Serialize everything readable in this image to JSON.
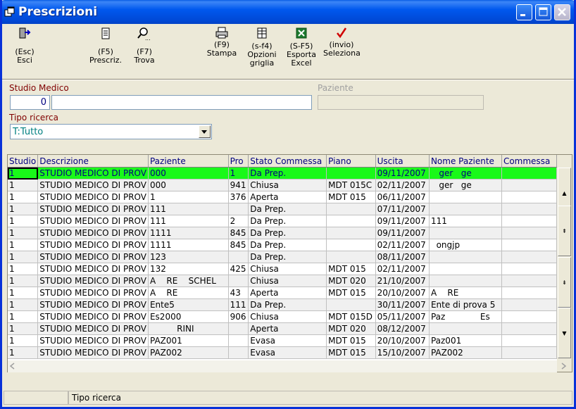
{
  "window": {
    "title": "Prescrizioni"
  },
  "toolbar": [
    {
      "key": "(Esc)",
      "label": "Esci",
      "icon": "exit-icon"
    },
    {
      "key": "(F5)",
      "label": "Prescriz.",
      "icon": "document-icon"
    },
    {
      "key": "(F7)",
      "label": "Trova",
      "icon": "magnifier-icon"
    },
    {
      "key": "(F9)",
      "label": "Stampa",
      "icon": "printer-icon"
    },
    {
      "key": "(s-f4)",
      "label": "Opzioni griglia",
      "label2": "griglia",
      "label1": "Opzioni",
      "icon": "grid-options-icon"
    },
    {
      "key": "(S-F5)",
      "label1": "Esporta",
      "label2": "Excel",
      "icon": "excel-icon"
    },
    {
      "key": "(invio)",
      "label": "Seleziona",
      "icon": "checkmark-icon"
    }
  ],
  "filters": {
    "studio_label": "Studio Medico",
    "studio_code": "0",
    "studio_name": "",
    "paziente_label": "Paziente",
    "paziente_value": "",
    "tipo_label": "Tipo ricerca",
    "tipo_value": "T:Tutto"
  },
  "grid": {
    "columns": [
      "Studio",
      "Descrizione",
      "Paziente",
      "Pro",
      "Stato Commessa",
      "Piano",
      "Uscita",
      "Nome Paziente",
      "Commessa"
    ],
    "rows": [
      [
        "1",
        "STUDIO MEDICO DI PROV",
        "000",
        "1",
        "Da Prep.",
        "",
        "09/11/2007",
        "   ger   ge",
        ""
      ],
      [
        "1",
        "STUDIO MEDICO DI PROV",
        "000",
        "941",
        "Chiusa",
        "MDT 015C",
        "02/11/2007",
        "   ger   ge",
        ""
      ],
      [
        "1",
        "STUDIO MEDICO DI PROV",
        "1",
        "376",
        "Aperta",
        "MDT 015",
        "06/11/2007",
        "",
        ""
      ],
      [
        "1",
        "STUDIO MEDICO DI PROV",
        "111",
        "",
        "Da Prep.",
        "",
        "07/11/2007",
        "",
        ""
      ],
      [
        "1",
        "STUDIO MEDICO DI PROV",
        "111",
        "2",
        "Da Prep.",
        "",
        "09/11/2007",
        "111",
        ""
      ],
      [
        "1",
        "STUDIO MEDICO DI PROV",
        "1111",
        "845",
        "Da Prep.",
        "",
        "09/11/2007",
        "",
        ""
      ],
      [
        "1",
        "STUDIO MEDICO DI PROV",
        "1111",
        "845",
        "Da Prep.",
        "",
        "02/11/2007",
        "  ongjp",
        ""
      ],
      [
        "1",
        "STUDIO MEDICO DI PROV",
        "123",
        "",
        "Da Prep.",
        "",
        "08/11/2007",
        "",
        ""
      ],
      [
        "1",
        "STUDIO MEDICO DI PROV",
        "132",
        "425",
        "Chiusa",
        "MDT 015",
        "02/11/2007",
        "",
        ""
      ],
      [
        "1",
        "STUDIO MEDICO DI PROV",
        "A    RE    SCHEL",
        "",
        "Chiusa",
        "MDT 020",
        "21/10/2007",
        "",
        ""
      ],
      [
        "1",
        "STUDIO MEDICO DI PROV",
        "A    RE",
        "43",
        "Aperta",
        "MDT 015",
        "20/10/2007",
        "A    RE",
        ""
      ],
      [
        "1",
        "STUDIO MEDICO DI PROV",
        "Ente5",
        "111",
        "Da Prep.",
        "",
        "30/11/2007",
        "Ente di prova 5",
        ""
      ],
      [
        "1",
        "STUDIO MEDICO DI PROV",
        "Es2000",
        "906",
        "Chiusa",
        "MDT 015D",
        "05/11/2007",
        "Paz             Es",
        ""
      ],
      [
        "1",
        "STUDIO MEDICO DI PROV",
        "          RINI",
        "",
        "Aperta",
        "MDT 020",
        "08/12/2007",
        "",
        ""
      ],
      [
        "1",
        "STUDIO MEDICO DI PROV",
        "PAZ001",
        "",
        "Evasa",
        "MDT 015",
        "20/10/2007",
        "Paz001",
        ""
      ],
      [
        "1",
        "STUDIO MEDICO DI PROV",
        "PAZ002",
        "",
        "Evasa",
        "MDT 015",
        "15/10/2007",
        "PAZ002",
        ""
      ]
    ]
  },
  "status": {
    "panel1": "",
    "panel2": "Tipo ricerca"
  },
  "colors": {
    "selected_row": "#19f919",
    "title_bar": "#0058ee",
    "label_red": "#800000"
  }
}
